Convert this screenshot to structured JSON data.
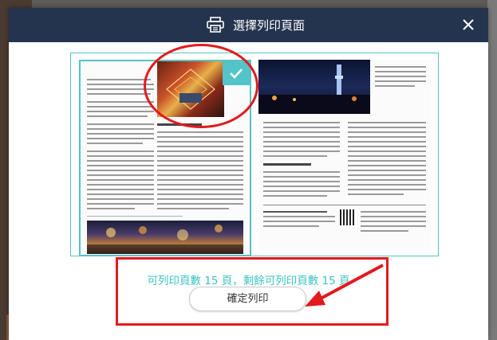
{
  "dialog": {
    "title": "選擇列印頁面",
    "print_icon": "printer-icon",
    "close_icon": "close-icon"
  },
  "preview": {
    "left_page_selected": true,
    "check_icon": "checkmark-icon",
    "caption_left": "■ ■ ■",
    "caption_right": "■"
  },
  "footer": {
    "remaining_text": "可列印頁數 15 頁，剩餘可列印頁數 15 頁",
    "confirm_label": "確定列印"
  },
  "colors": {
    "header_bg": "#24344f",
    "accent": "#53c4c8",
    "annotation_red": "#e3191d"
  }
}
